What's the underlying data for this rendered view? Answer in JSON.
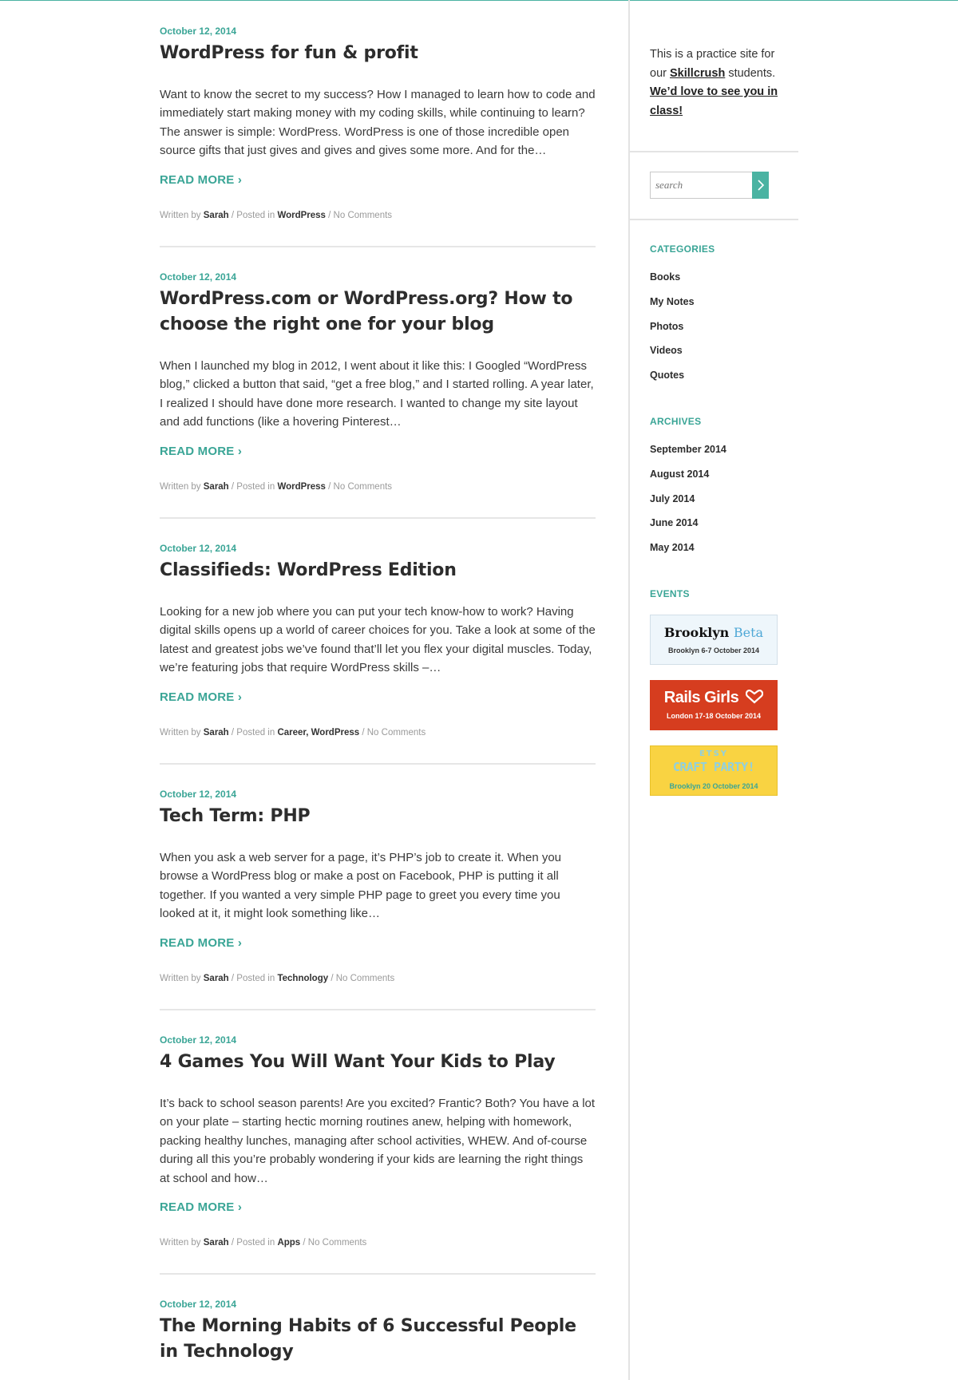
{
  "colors": {
    "accent": "#3aa596",
    "text": "#333333",
    "rails_girls": "#d63d1f",
    "etsy": "#f9d342"
  },
  "posts": [
    {
      "date": "October 12, 2014",
      "title": "WordPress for fun & profit",
      "excerpt": "Want to know the secret to my success? How I managed to learn how to code and immediately start making money with my coding skills, while continuing to learn? The answer is simple: WordPress. WordPress is one of those incredible open source gifts that just gives and gives and gives some more. And for the…",
      "read_more": "READ MORE ›",
      "meta_written": "Written by ",
      "author": "Sarah",
      "meta_posted": " / Posted in ",
      "categories": "WordPress",
      "comments": " / No Comments"
    },
    {
      "date": "October 12, 2014",
      "title": "WordPress.com or WordPress.org? How to choose the right one for your blog",
      "excerpt": "When I launched my blog in 2012, I went about it like this: I Googled “WordPress blog,” clicked a button that said, “get a free blog,” and I started rolling. A year later, I realized I should have done more research. I wanted to change my site layout and add functions (like a hovering Pinterest…",
      "read_more": "READ MORE ›",
      "meta_written": "Written by ",
      "author": "Sarah",
      "meta_posted": " / Posted in ",
      "categories": "WordPress",
      "comments": " / No Comments"
    },
    {
      "date": "October 12, 2014",
      "title": "Classifieds: WordPress Edition",
      "excerpt": "Looking for a new job where you can put your tech know-how to work? Having digital skills opens up a world of career choices for you. Take a look at some of the latest and greatest jobs we’ve found that’ll let you flex your digital muscles. Today, we’re featuring jobs that require WordPress skills –…",
      "read_more": "READ MORE ›",
      "meta_written": "Written by ",
      "author": "Sarah",
      "meta_posted": " / Posted in ",
      "categories": "Career, WordPress",
      "comments": " / No Comments"
    },
    {
      "date": "October 12, 2014",
      "title": "Tech Term: PHP",
      "excerpt": "When you ask a web server for a page, it’s PHP’s job to create it. When you browse a WordPress blog or make a post on Facebook, PHP is putting it all together. If you wanted a very simple PHP page to greet you every time you looked at it, it might look something like…",
      "read_more": "READ MORE ›",
      "meta_written": "Written by ",
      "author": "Sarah",
      "meta_posted": " / Posted in ",
      "categories": "Technology",
      "comments": " / No Comments"
    },
    {
      "date": "October 12, 2014",
      "title": "4 Games You Will Want Your Kids to Play",
      "excerpt": "It’s back to school season parents! Are you excited? Frantic? Both? You have a lot on your plate – starting hectic morning routines anew, helping with homework, packing healthy lunches, managing after school activities, WHEW. And of-course during all this you’re probably wondering if your kids are learning the right things at school and how…",
      "read_more": "READ MORE ›",
      "meta_written": "Written by ",
      "author": "Sarah",
      "meta_posted": " / Posted in ",
      "categories": "Apps",
      "comments": " / No Comments"
    },
    {
      "date": "October 12, 2014",
      "title": "The Morning Habits of 6 Successful People in Technology"
    }
  ],
  "sidebar": {
    "about_1": "This is a practice site for our ",
    "about_link": "Skillcrush",
    "about_2": " students.",
    "about_cta": "We’d love to see you in class!",
    "search_placeholder": "search",
    "search_icon": "chevron-right-icon",
    "categories_heading": "CATEGORIES",
    "categories": [
      "Books",
      "My Notes",
      "Photos",
      "Videos",
      "Quotes"
    ],
    "archives_heading": "ARCHIVES",
    "archives": [
      "September 2014",
      "August 2014",
      "July 2014",
      "June 2014",
      "May 2014"
    ],
    "events_heading": "EVENTS",
    "events": [
      {
        "title": "Brooklyn ",
        "title_2": "Beta",
        "subtitle": "Brooklyn 6-7 October 2014"
      },
      {
        "title": "Rails Girls",
        "subtitle": "London 17-18 October 2014",
        "icon": "heart-icon"
      },
      {
        "title": "ETSY",
        "title_2": "CRAFT PARTY!",
        "subtitle": "Brooklyn 20 October 2014"
      }
    ]
  }
}
